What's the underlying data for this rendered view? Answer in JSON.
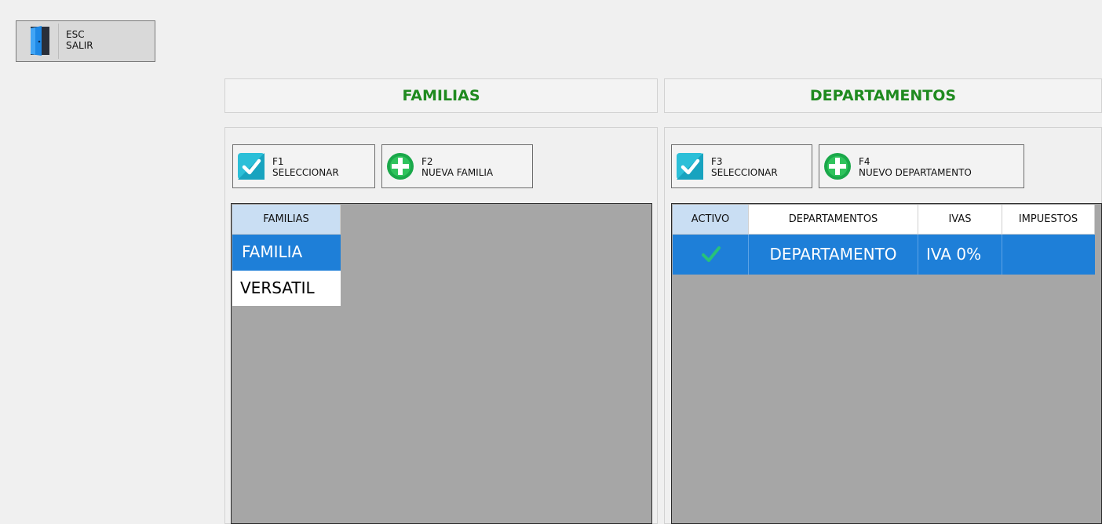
{
  "exit": {
    "key": "ESC",
    "label": "SALIR",
    "icon": "door-icon"
  },
  "familias": {
    "header": "FAMILIAS",
    "buttons": {
      "select": {
        "key": "F1",
        "label": "SELECCIONAR",
        "icon": "checkmark-icon"
      },
      "new": {
        "key": "F2",
        "label": "NUEVA FAMILIA",
        "icon": "add-icon"
      }
    },
    "grid": {
      "column": "FAMILIAS",
      "rows": [
        "FAMILIA",
        "VERSATIL"
      ],
      "selected_row": 0
    }
  },
  "departamentos": {
    "header": "DEPARTAMENTOS",
    "buttons": {
      "select": {
        "key": "F3",
        "label": "SELECCIONAR",
        "icon": "checkmark-icon"
      },
      "new": {
        "key": "F4",
        "label": "NUEVO DEPARTAMENTO",
        "icon": "add-icon"
      }
    },
    "grid": {
      "columns": [
        "ACTIVO",
        "DEPARTAMENTOS",
        "IVAS",
        "IMPUESTOS"
      ],
      "rows": [
        {
          "activo": true,
          "departamento": "DEPARTAMENTO",
          "iva": "IVA 0%",
          "impuestos": ""
        }
      ]
    }
  },
  "colors": {
    "header_text": "#1f8a1f",
    "selection": "#1e7fd8",
    "grid_background": "#a6a6a6",
    "column_header_selected": "#c9def3"
  }
}
